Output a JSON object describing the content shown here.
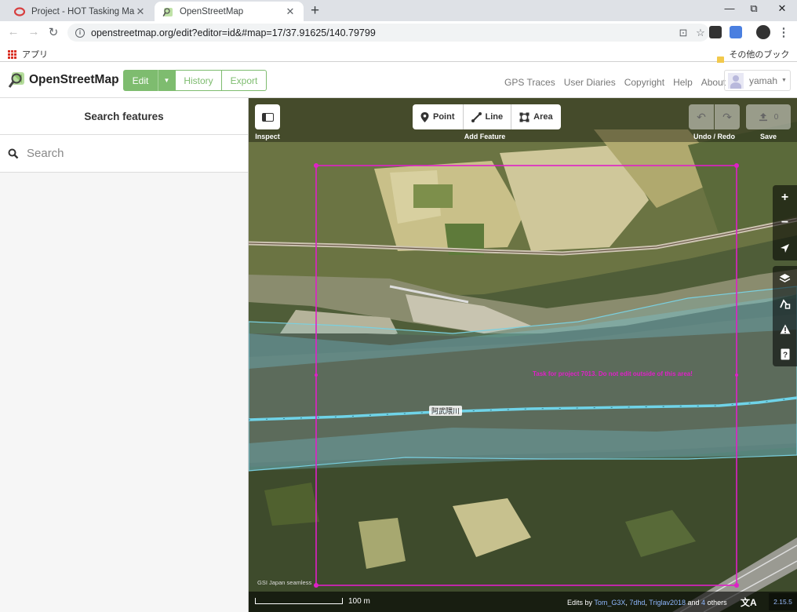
{
  "browser": {
    "tabs": [
      {
        "title": "Project - HOT Tasking Manager",
        "active": false
      },
      {
        "title": "OpenStreetMap",
        "active": true
      }
    ],
    "new_tab": "+",
    "window_controls": {
      "minimize": "—",
      "restore": "⧉",
      "close": "✕"
    },
    "url": "openstreetmap.org/edit?editor=id&#map=17/37.91625/140.79799",
    "bookmarks": {
      "apps_label": "アプリ",
      "other_label": "その他のブックマーク"
    }
  },
  "osm_header": {
    "site_name": "OpenStreetMap",
    "edit_label": "Edit",
    "history_label": "History",
    "export_label": "Export",
    "nav_links": [
      "GPS Traces",
      "User Diaries",
      "Copyright",
      "Help",
      "About"
    ],
    "username": "yamah",
    "accent_color": "#7ebc6f"
  },
  "sidebar": {
    "title": "Search features",
    "search_placeholder": "Search"
  },
  "map": {
    "top_bar": {
      "inspect_label": "Inspect",
      "add_feature_label": "Add Feature",
      "point_label": "Point",
      "line_label": "Line",
      "area_label": "Area",
      "undo_redo_label": "Undo / Redo",
      "save_label": "Save",
      "save_count": "0"
    },
    "map_controls": [
      "zoom-in",
      "zoom-out",
      "geolocate",
      "background-layers",
      "map-data",
      "issues",
      "help"
    ],
    "task_label": "Task for project 7013. Do not edit outside of this area!",
    "task_color": "#e020c8",
    "river_label": "阿武隈川",
    "attribution": "GSI Japan seamless",
    "footer": {
      "scale_label": "100 m",
      "edits_by": "Edits by",
      "editors": [
        "Tom_G3X",
        "7dhd",
        "Triglav2018"
      ],
      "and_text": "and",
      "others_count": "4",
      "others_text": "others",
      "language_icon": "文A",
      "version": "2.15.5"
    }
  }
}
